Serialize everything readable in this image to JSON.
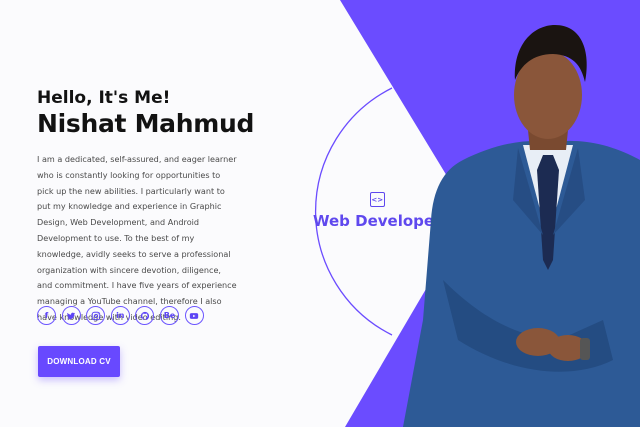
{
  "hero": {
    "greeting": "Hello, It's Me!",
    "name": "Nishat Mahmud",
    "bio": "I am a dedicated, self-assured, and eager learner who is constantly looking for opportunities to pick up the new abilities. I particularly want to put my knowledge and experience in Graphic Design, Web Development, and Android Development to use. To the best of my knowledge, avidly seeks to serve a professional organization with sincere devotion, diligence, and commitment. I have five years of experience managing a YouTube channel, therefore I also have knowledge with video editing.",
    "download_label": "DOWNLOAD CV"
  },
  "socials": [
    {
      "name": "facebook-icon",
      "glyph": "f"
    },
    {
      "name": "twitter-icon",
      "glyph": ""
    },
    {
      "name": "instagram-icon",
      "glyph": ""
    },
    {
      "name": "linkedin-icon",
      "glyph": "in"
    },
    {
      "name": "github-icon",
      "glyph": ""
    },
    {
      "name": "behance-icon",
      "glyph": "Be"
    },
    {
      "name": "youtube-icon",
      "glyph": ""
    }
  ],
  "role": {
    "icon_glyph": "<>",
    "label": "Web Developer"
  },
  "colors": {
    "accent": "#6849ff",
    "background": "#fbfbfd",
    "text": "#121212",
    "body_text": "#4a4a4a"
  }
}
